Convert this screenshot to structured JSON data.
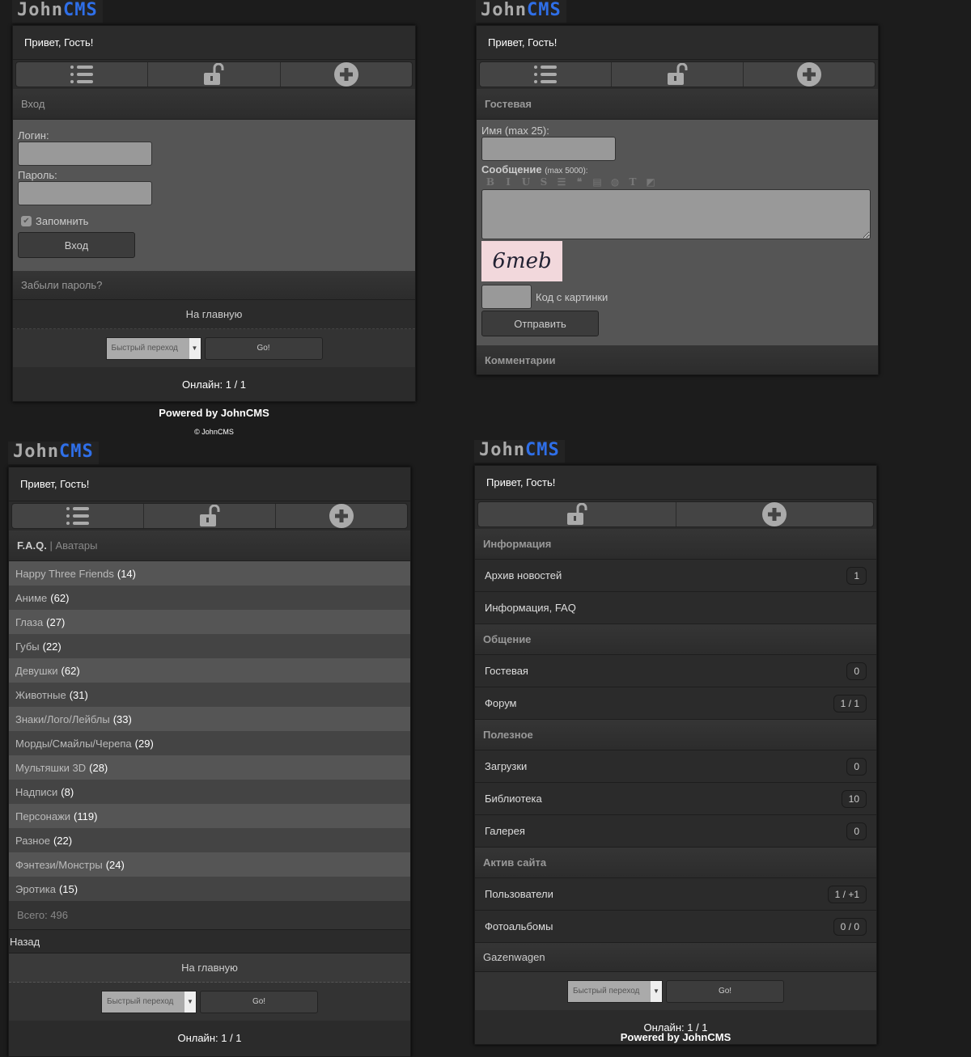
{
  "logo": {
    "part1": "John",
    "part2": "CMS"
  },
  "greeting": "Привет, Гость!",
  "nav_icons": [
    "list-icon",
    "unlock-icon",
    "plus-circle-icon"
  ],
  "footer": {
    "home": "На главную",
    "quick_jump": "Быстрый переход",
    "go": "Go!",
    "online": "Онлайн: 1 / 1",
    "powered": "Powered by JohnCMS",
    "copyright": "© JohnCMS"
  },
  "login": {
    "header": "Вход",
    "login_label": "Логин:",
    "login_value": "",
    "password_label": "Пароль:",
    "password_value": "",
    "remember": "Запомнить",
    "remember_checked": true,
    "submit": "Вход",
    "forgot": "Забыли пароль?"
  },
  "guestbook": {
    "header": "Гостевая",
    "name_label": "Имя (max 25):",
    "name_value": "",
    "message_label": "Сообщение",
    "message_hint": "(max 5000):",
    "message_value": "",
    "toolbar": [
      "bold",
      "italic",
      "underline",
      "strike",
      "list",
      "quote",
      "php",
      "url",
      "text-color",
      "bg-color"
    ],
    "captcha_text": "6meb",
    "captcha_label": "Код с картинки",
    "captcha_value": "",
    "submit": "Отправить",
    "comments": "Комментарии"
  },
  "faq": {
    "title": "F.A.Q.",
    "separator": "|",
    "section": "Аватары",
    "items": [
      {
        "name": "Happy Three Friends",
        "count": "(14)"
      },
      {
        "name": "Аниме",
        "count": "(62)"
      },
      {
        "name": "Глаза",
        "count": "(27)"
      },
      {
        "name": "Губы",
        "count": "(22)"
      },
      {
        "name": "Девушки",
        "count": "(62)"
      },
      {
        "name": "Животные",
        "count": "(31)"
      },
      {
        "name": "Знаки/Лого/Лейблы",
        "count": "(33)"
      },
      {
        "name": "Морды/Смайлы/Черепа",
        "count": "(29)"
      },
      {
        "name": "Мультяшки 3D",
        "count": "(28)"
      },
      {
        "name": "Надписи",
        "count": "(8)"
      },
      {
        "name": "Персонажи",
        "count": "(119)"
      },
      {
        "name": "Разное",
        "count": "(22)"
      },
      {
        "name": "Фэнтези/Монстры",
        "count": "(24)"
      },
      {
        "name": "Эротика",
        "count": "(15)"
      }
    ],
    "total": "Всего: 496",
    "back": "Назад"
  },
  "menu": {
    "sections": [
      {
        "title": "Информация",
        "items": [
          {
            "label": "Архив новостей",
            "badge": "1"
          },
          {
            "label": "Информация, FAQ",
            "badge": ""
          }
        ]
      },
      {
        "title": "Общение",
        "items": [
          {
            "label": "Гостевая",
            "badge": "0"
          },
          {
            "label": "Форум",
            "badge": "1 / 1"
          }
        ]
      },
      {
        "title": "Полезное",
        "items": [
          {
            "label": "Загрузки",
            "badge": "0"
          },
          {
            "label": "Библиотека",
            "badge": "10"
          },
          {
            "label": "Галерея",
            "badge": "0"
          }
        ]
      },
      {
        "title": "Актив сайта",
        "items": [
          {
            "label": "Пользователи",
            "badge": "1 / +1"
          },
          {
            "label": "Фотоальбомы",
            "badge": "0 / 0"
          }
        ]
      }
    ],
    "last": "Gazenwagen"
  }
}
